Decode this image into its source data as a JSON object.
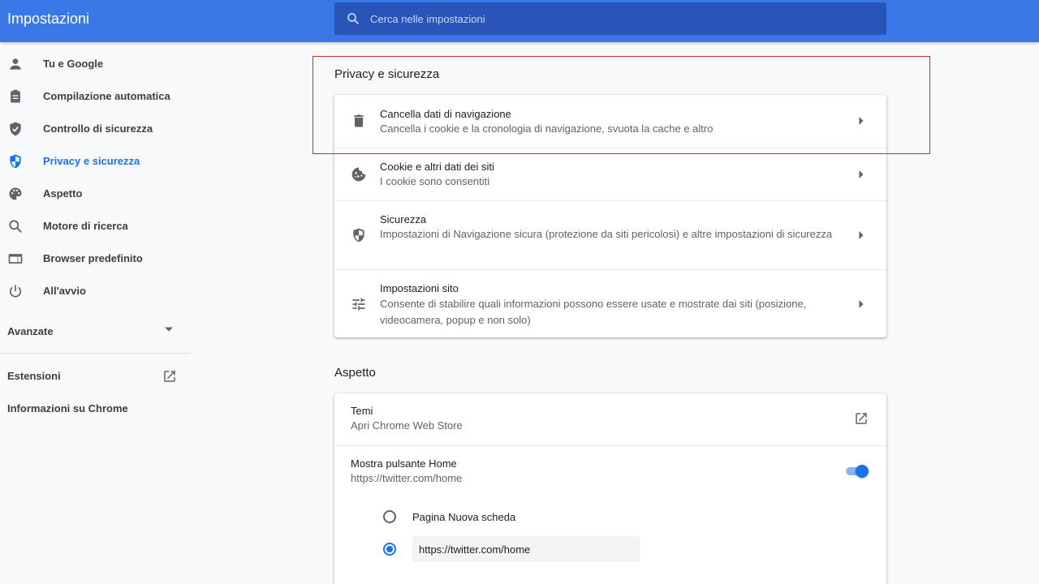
{
  "header": {
    "title": "Impostazioni",
    "search_placeholder": "Cerca nelle impostazioni"
  },
  "sidebar": {
    "items": [
      {
        "label": "Tu e Google",
        "icon": "person-icon"
      },
      {
        "label": "Compilazione automatica",
        "icon": "clipboard-icon"
      },
      {
        "label": "Controllo di sicurezza",
        "icon": "shield-check-icon"
      },
      {
        "label": "Privacy e sicurezza",
        "icon": "shield-icon",
        "active": true
      },
      {
        "label": "Aspetto",
        "icon": "palette-icon"
      },
      {
        "label": "Motore di ricerca",
        "icon": "search-icon"
      },
      {
        "label": "Browser predefinito",
        "icon": "browser-icon"
      },
      {
        "label": "All'avvio",
        "icon": "power-icon"
      }
    ],
    "advanced_label": "Avanzate",
    "extensions_label": "Estensioni",
    "about_label": "Informazioni su Chrome"
  },
  "privacy": {
    "title": "Privacy e sicurezza",
    "rows": [
      {
        "title": "Cancella dati di navigazione",
        "subtitle": "Cancella i cookie e la cronologia di navigazione, svuota la cache e altro",
        "icon": "trash-icon"
      },
      {
        "title": "Cookie e altri dati dei siti",
        "subtitle": "I cookie sono consentiti",
        "icon": "cookie-icon"
      },
      {
        "title": "Sicurezza",
        "subtitle": "Impostazioni di Navigazione sicura (protezione da siti pericolosi) e altre impostazioni di sicurezza",
        "icon": "shield-icon"
      },
      {
        "title": "Impostazioni sito",
        "subtitle": "Consente di stabilire quali informazioni possono essere usate e mostrate dai siti (posizione, videocamera, popup e non solo)",
        "icon": "tune-icon"
      }
    ]
  },
  "appearance": {
    "title": "Aspetto",
    "themes_title": "Temi",
    "themes_subtitle": "Apri Chrome Web Store",
    "home_title": "Mostra pulsante Home",
    "home_subtitle": "https://twitter.com/home",
    "home_enabled": true,
    "radio_new_tab_label": "Pagina Nuova scheda",
    "radio_selected": "custom",
    "custom_url_value": "https://twitter.com/home"
  },
  "colors": {
    "accent": "#1a73e8",
    "header": "#3b78e7",
    "highlight": "#d9242d"
  }
}
